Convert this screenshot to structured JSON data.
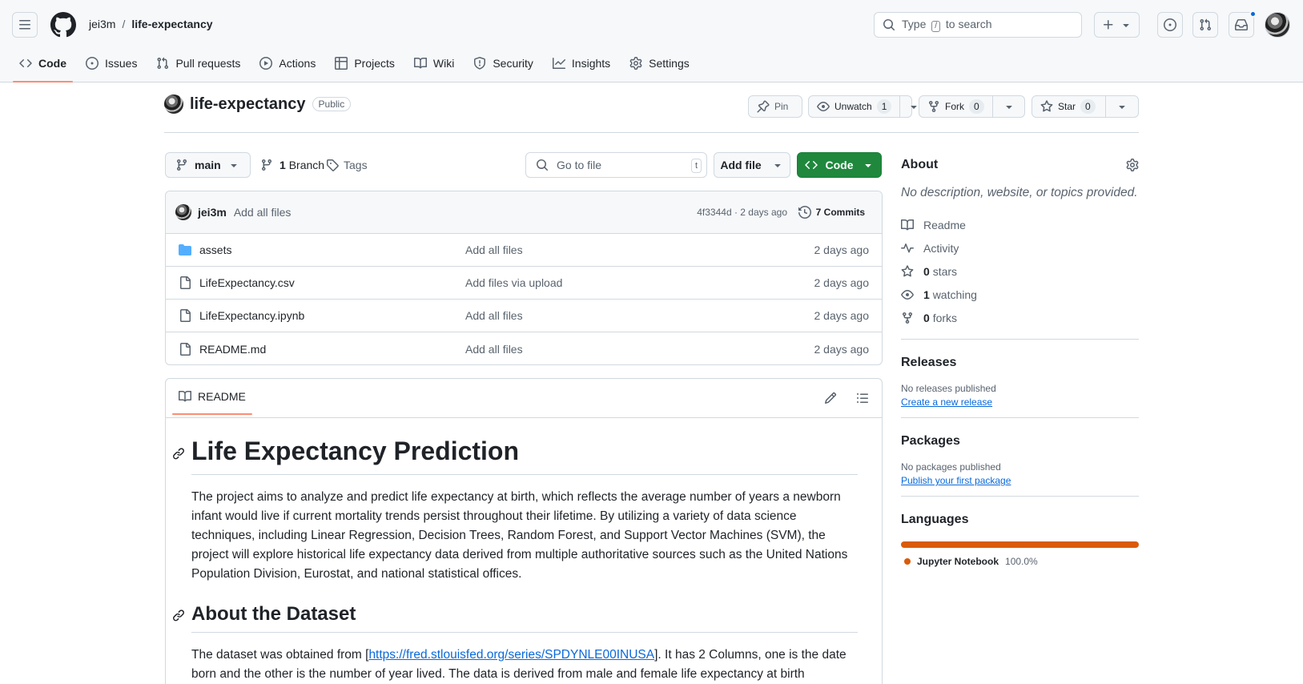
{
  "header": {
    "owner": "jei3m",
    "separator": "/",
    "repo": "life-expectancy",
    "search_prefix": "Type",
    "search_key": "/",
    "search_suffix": "to search"
  },
  "nav": {
    "tabs": [
      {
        "label": "Code",
        "icon": "code-icon"
      },
      {
        "label": "Issues",
        "icon": "issue-icon"
      },
      {
        "label": "Pull requests",
        "icon": "pull-request-icon"
      },
      {
        "label": "Actions",
        "icon": "play-icon"
      },
      {
        "label": "Projects",
        "icon": "table-icon"
      },
      {
        "label": "Wiki",
        "icon": "book-icon"
      },
      {
        "label": "Security",
        "icon": "shield-icon"
      },
      {
        "label": "Insights",
        "icon": "graph-icon"
      },
      {
        "label": "Settings",
        "icon": "gear-icon"
      }
    ]
  },
  "repo_header": {
    "name": "life-expectancy",
    "visibility": "Public",
    "pin_label": "Pin",
    "unwatch_label": "Unwatch",
    "watch_count": "1",
    "fork_label": "Fork",
    "fork_count": "0",
    "star_label": "Star",
    "star_count": "0"
  },
  "toolbar": {
    "branch": "main",
    "branch_count": "1",
    "branch_word": "Branch",
    "tags_label": "Tags",
    "goto_placeholder": "Go to file",
    "goto_key": "t",
    "add_file_label": "Add file",
    "code_label": "Code"
  },
  "commit": {
    "author": "jei3m",
    "message": "Add all files",
    "meta": "4f3344d · 2 days ago",
    "commits_label": "7 Commits"
  },
  "files": [
    {
      "name": "assets",
      "type": "folder",
      "message": "Add all files",
      "date": "2 days ago"
    },
    {
      "name": "LifeExpectancy.csv",
      "type": "file",
      "message": "Add files via upload",
      "date": "2 days ago"
    },
    {
      "name": "LifeExpectancy.ipynb",
      "type": "file",
      "message": "Add all files",
      "date": "2 days ago"
    },
    {
      "name": "README.md",
      "type": "file",
      "message": "Add all files",
      "date": "2 days ago"
    }
  ],
  "readme": {
    "tab_label": "README",
    "h1": "Life Expectancy Prediction",
    "intro": "The project aims to analyze and predict life expectancy at birth, which reflects the average number of years a newborn infant would live if current mortality trends persist throughout their lifetime. By utilizing a variety of data science techniques, including Linear Regression, Decision Trees, Random Forest, and Support Vector Machines (SVM), the project will explore historical life expectancy data derived from multiple authoritative sources such as the United Nations Population Division, Eurostat, and national statistical offices.",
    "h2": "About the Dataset",
    "dataset_prefix": "The dataset was obtained from [",
    "dataset_link": "https://fred.stlouisfed.org/series/SPDYNLE00INUSA",
    "dataset_suffix": "]. It has 2 Columns, one is the date born and the other is the number of year lived. The data is derived from male and female life expectancy at birth"
  },
  "sidebar": {
    "about_title": "About",
    "about_desc": "No description, website, or topics provided.",
    "readme_label": "Readme",
    "activity_label": "Activity",
    "stars_count": "0",
    "stars_label": "stars",
    "watching_count": "1",
    "watching_label": "watching",
    "forks_count": "0",
    "forks_label": "forks",
    "releases_title": "Releases",
    "releases_text": "No releases published",
    "releases_link": "Create a new release",
    "packages_title": "Packages",
    "packages_text": "No packages published",
    "packages_link": "Publish your first package",
    "languages_title": "Languages",
    "languages": [
      {
        "name": "Jupyter Notebook",
        "percent": "100.0%",
        "color": "#da5b0b"
      }
    ]
  },
  "colors": {
    "accent": "#0969da",
    "code_button": "#1f883d",
    "active_tab_underline": "#fd8c73",
    "notification_dot": "#0969da"
  }
}
